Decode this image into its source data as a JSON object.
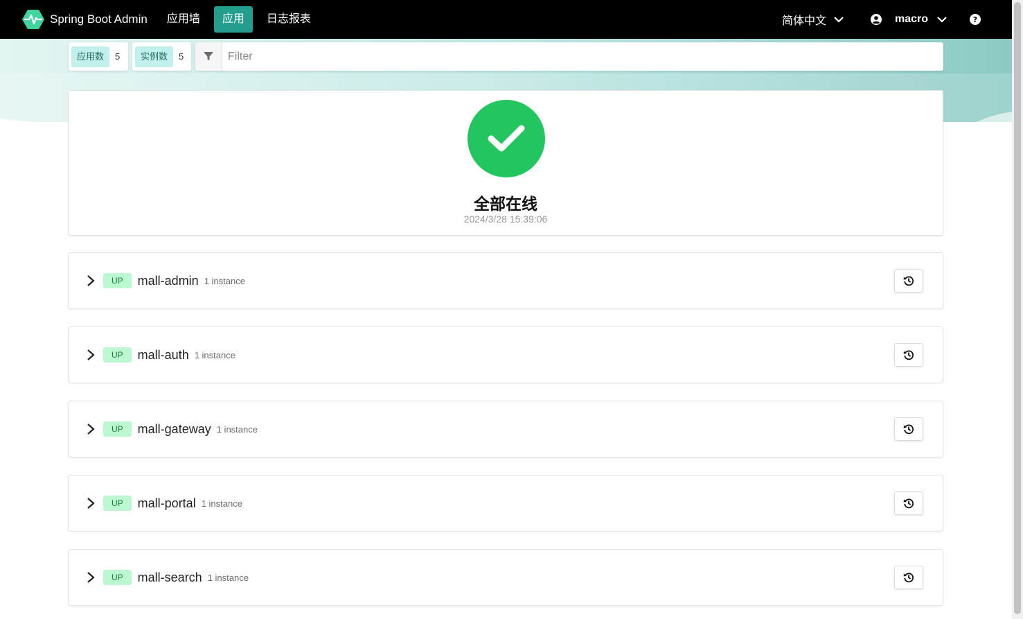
{
  "navbar": {
    "brand": "Spring Boot Admin",
    "items": [
      {
        "label": "应用墙",
        "active": false
      },
      {
        "label": "应用",
        "active": true
      },
      {
        "label": "日志报表",
        "active": false
      }
    ],
    "language": "简体中文",
    "username": "macro"
  },
  "toolbar": {
    "apps_label": "应用数",
    "apps_count": "5",
    "instances_label": "实例数",
    "instances_count": "5",
    "filter_placeholder": "Filter"
  },
  "status": {
    "title": "全部在线",
    "timestamp": "2024/3/28 15:39:06",
    "color": "#22c55e"
  },
  "applications": [
    {
      "status": "UP",
      "name": "mall-admin",
      "instances": "1 instance"
    },
    {
      "status": "UP",
      "name": "mall-auth",
      "instances": "1 instance"
    },
    {
      "status": "UP",
      "name": "mall-gateway",
      "instances": "1 instance"
    },
    {
      "status": "UP",
      "name": "mall-portal",
      "instances": "1 instance"
    },
    {
      "status": "UP",
      "name": "mall-search",
      "instances": "1 instance"
    }
  ],
  "colors": {
    "nav_bg": "#000000",
    "nav_active": "#239d8d",
    "up_badge_bg": "#bbf7d0",
    "up_badge_text": "#15803d",
    "tag_bg": "#bff0ea"
  },
  "icons": {
    "brand": "heartbeat-logo-icon",
    "language": "chevron-down-icon",
    "user": "user-circle-icon",
    "help": "question-circle-icon",
    "filter": "filter-icon",
    "status": "check-icon",
    "row_expand": "chevron-right-icon",
    "history": "history-icon"
  }
}
